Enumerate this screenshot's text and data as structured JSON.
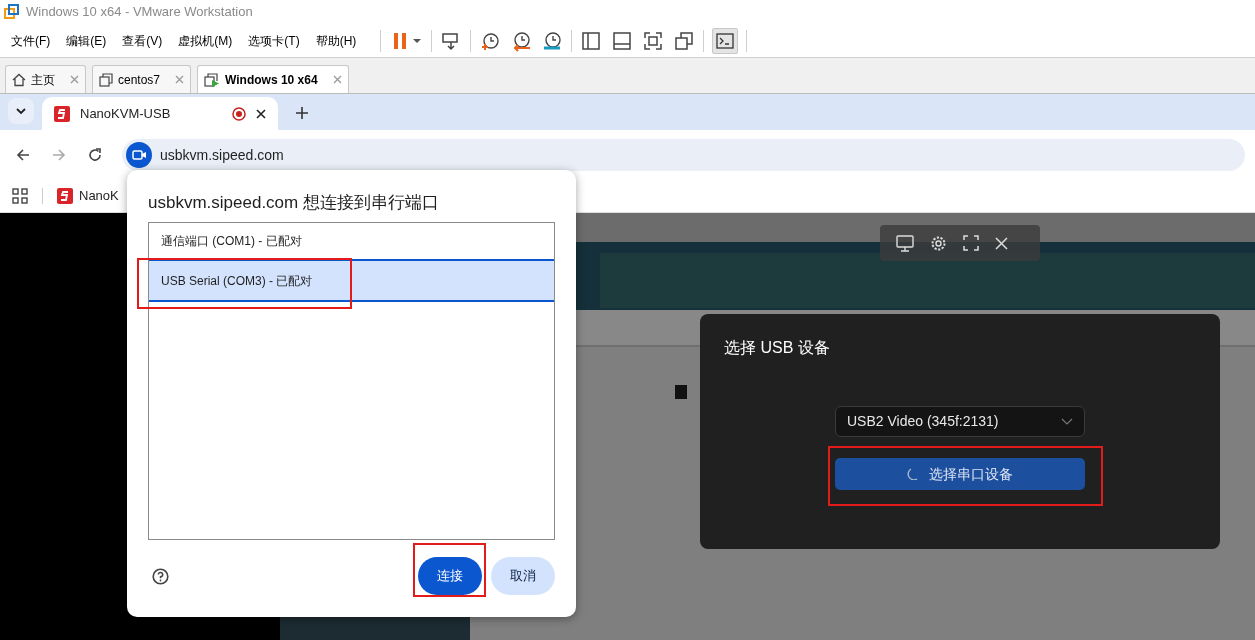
{
  "window": {
    "title": "Windows 10 x64 - VMware Workstation"
  },
  "menu": [
    "文件(F)",
    "编辑(E)",
    "查看(V)",
    "虚拟机(M)",
    "选项卡(T)",
    "帮助(H)"
  ],
  "vm_tabs": [
    {
      "label": "主页",
      "kind": "home",
      "selected": false
    },
    {
      "label": "centos7",
      "kind": "vm",
      "selected": false
    },
    {
      "label": "Windows 10 x64",
      "kind": "running_vm",
      "selected": true
    }
  ],
  "browser": {
    "tabs": [
      {
        "title": "NanoKVM-USB",
        "selected": true,
        "recording": true
      }
    ],
    "url": "usbkvm.sipeed.com",
    "bookmarks": [
      {
        "label": "NanoK"
      }
    ]
  },
  "remote_dialog": {
    "title": "选择 USB 设备",
    "video_select": {
      "value": "USB2 Video (345f:2131)"
    },
    "serial_button": {
      "label": "选择串口设备",
      "loading": true,
      "highlighted": true
    }
  },
  "serial_prompt": {
    "title": "usbkvm.sipeed.com 想连接到串行端口",
    "ports": [
      {
        "label": "通信端口 (COM1) - 已配对",
        "selected": false,
        "highlighted": false
      },
      {
        "label": "USB Serial (COM3) - 已配对",
        "selected": true,
        "highlighted": true
      }
    ],
    "buttons": [
      {
        "label": "连接",
        "kind": "primary",
        "highlighted": true
      },
      {
        "label": "取消",
        "kind": "secondary",
        "highlighted": false
      }
    ]
  }
}
